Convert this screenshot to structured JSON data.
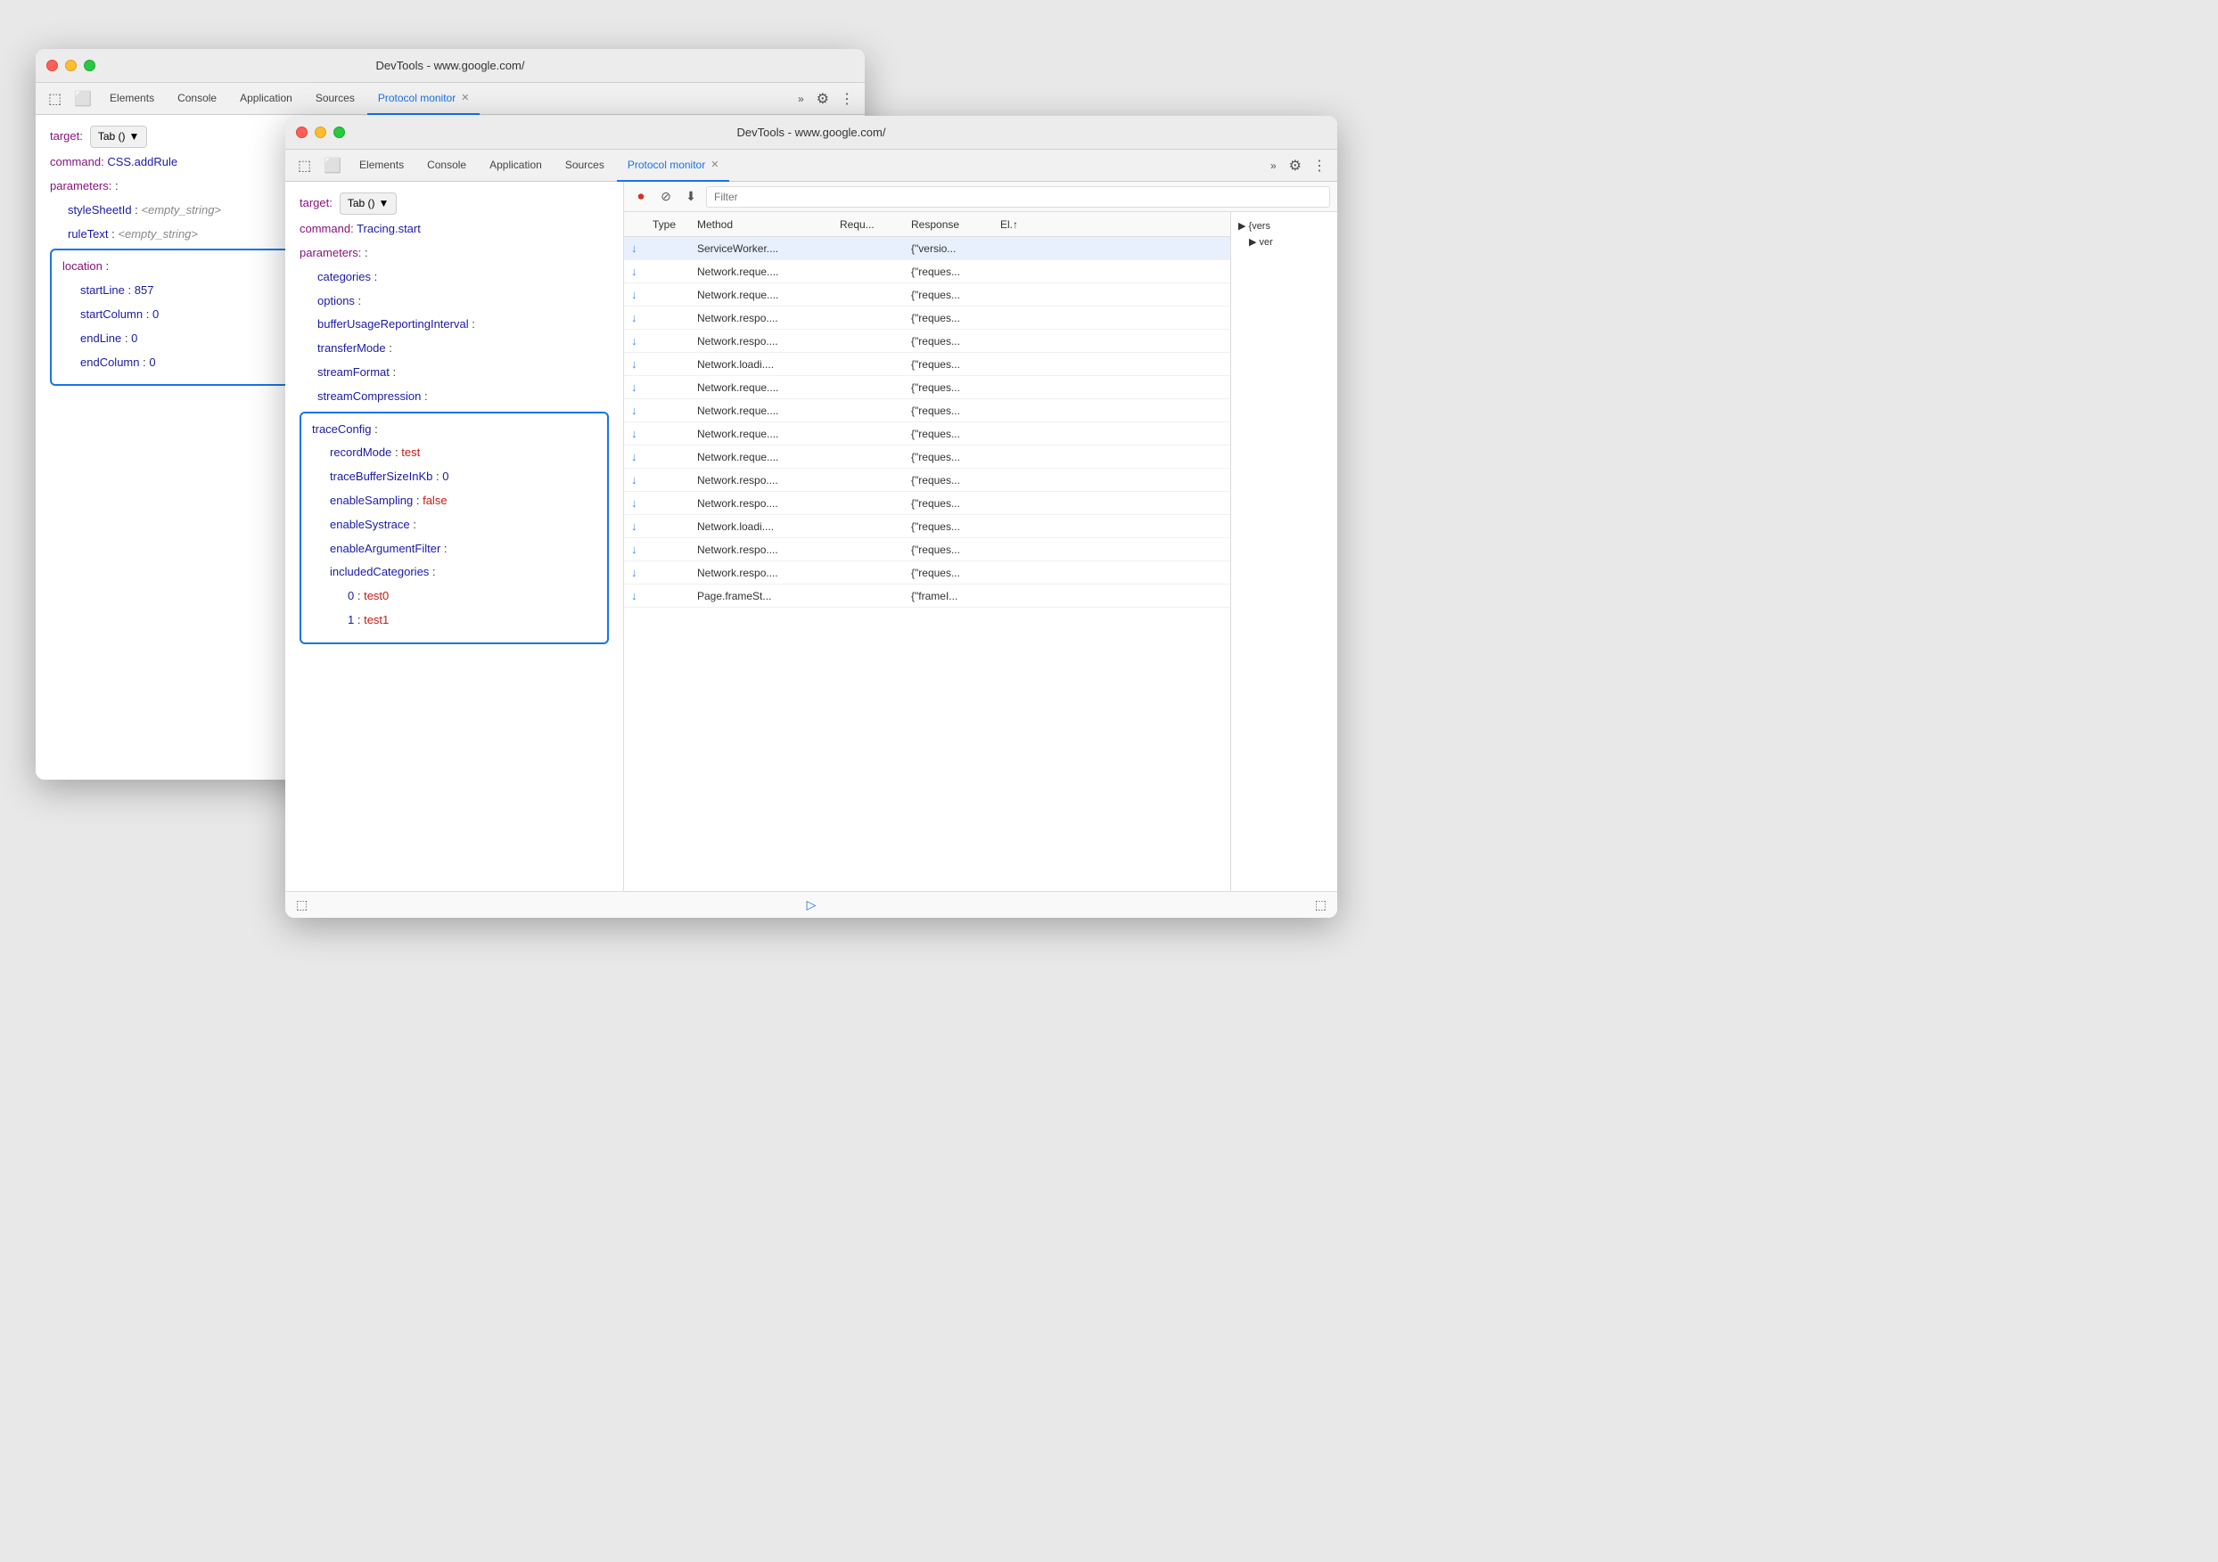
{
  "window1": {
    "title": "DevTools - www.google.com/",
    "tabs": [
      {
        "label": "Elements",
        "active": false
      },
      {
        "label": "Console",
        "active": false
      },
      {
        "label": "Application",
        "active": false
      },
      {
        "label": "Sources",
        "active": false
      },
      {
        "label": "Protocol monitor",
        "active": true
      }
    ],
    "target_label": "target:",
    "target_value": "Tab ()",
    "command_label": "command:",
    "command_value": "CSS.addRule",
    "parameters_label": "parameters:",
    "params": [
      {
        "key": "styleSheetId",
        "value": "<empty_string>",
        "indent": 1
      },
      {
        "key": "ruleText",
        "value": "<empty_string>",
        "indent": 1
      }
    ],
    "location_label": "location",
    "location_params": [
      {
        "key": "startLine",
        "value": "857"
      },
      {
        "key": "startColumn",
        "value": "0"
      },
      {
        "key": "endLine",
        "value": "0"
      },
      {
        "key": "endColumn",
        "value": "0"
      }
    ]
  },
  "window2": {
    "title": "DevTools - www.google.com/",
    "tabs": [
      {
        "label": "Elements",
        "active": false
      },
      {
        "label": "Console",
        "active": false
      },
      {
        "label": "Application",
        "active": false
      },
      {
        "label": "Sources",
        "active": false
      },
      {
        "label": "Protocol monitor",
        "active": true
      }
    ],
    "target_label": "target:",
    "target_value": "Tab ()",
    "command_label": "command:",
    "command_value": "Tracing.start",
    "parameters_label": "parameters:",
    "params": [
      {
        "key": "categories",
        "indent": 1
      },
      {
        "key": "options",
        "indent": 1
      },
      {
        "key": "bufferUsageReportingInterval",
        "indent": 1
      },
      {
        "key": "transferMode",
        "indent": 1
      },
      {
        "key": "streamFormat",
        "indent": 1
      },
      {
        "key": "streamCompression",
        "indent": 1
      }
    ],
    "traceConfig_label": "traceConfig",
    "traceConfig_params": [
      {
        "key": "recordMode",
        "value": "test"
      },
      {
        "key": "traceBufferSizeInKb",
        "value": "0"
      },
      {
        "key": "enableSampling",
        "value": "false"
      },
      {
        "key": "enableSystrace"
      },
      {
        "key": "enableArgumentFilter"
      },
      {
        "key": "includedCategories"
      },
      {
        "key": "0",
        "value": "test0",
        "indent": 1
      },
      {
        "key": "1",
        "value": "test1",
        "indent": 1
      }
    ],
    "log": {
      "filter_placeholder": "Filter",
      "headers": [
        "",
        "Type",
        "Method",
        "Requ...",
        "Response",
        "El.↑",
        ""
      ],
      "rows": [
        {
          "type": "↓",
          "method": "ServiceWorker....",
          "request": "",
          "response": "{\"versio...",
          "el": "",
          "selected": true
        },
        {
          "type": "↓",
          "method": "Network.reque....",
          "request": "",
          "response": "{\"reques...",
          "el": ""
        },
        {
          "type": "↓",
          "method": "Network.reque....",
          "request": "",
          "response": "{\"reques...",
          "el": ""
        },
        {
          "type": "↓",
          "method": "Network.respo....",
          "request": "",
          "response": "{\"reques...",
          "el": ""
        },
        {
          "type": "↓",
          "method": "Network.respo....",
          "request": "",
          "response": "{\"reques...",
          "el": ""
        },
        {
          "type": "↓",
          "method": "Network.loadi....",
          "request": "",
          "response": "{\"reques...",
          "el": ""
        },
        {
          "type": "↓",
          "method": "Network.reque....",
          "request": "",
          "response": "{\"reques...",
          "el": ""
        },
        {
          "type": "↓",
          "method": "Network.reque....",
          "request": "",
          "response": "{\"reques...",
          "el": ""
        },
        {
          "type": "↓",
          "method": "Network.reque....",
          "request": "",
          "response": "{\"reques...",
          "el": ""
        },
        {
          "type": "↓",
          "method": "Network.reque....",
          "request": "",
          "response": "{\"reques...",
          "el": ""
        },
        {
          "type": "↓",
          "method": "Network.respo....",
          "request": "",
          "response": "{\"reques...",
          "el": ""
        },
        {
          "type": "↓",
          "method": "Network.respo....",
          "request": "",
          "response": "{\"reques...",
          "el": ""
        },
        {
          "type": "↓",
          "method": "Network.loadi....",
          "request": "",
          "response": "{\"reques...",
          "el": ""
        },
        {
          "type": "↓",
          "method": "Network.respo....",
          "request": "",
          "response": "{\"reques...",
          "el": ""
        },
        {
          "type": "↓",
          "method": "Network.respo....",
          "request": "",
          "response": "{\"reques...",
          "el": ""
        },
        {
          "type": "↓",
          "method": "Page.frameSt...",
          "request": "",
          "response": "{\"frameI...",
          "el": ""
        }
      ]
    },
    "preview": "{\"vers\n  ▶ ver"
  },
  "colors": {
    "accent_blue": "#1a73e8",
    "tab_active": "#1a73e8",
    "key_color": "#1a1aa6",
    "label_color": "#881280",
    "string_color": "#c41a16",
    "border_highlight": "#1a73e8"
  }
}
